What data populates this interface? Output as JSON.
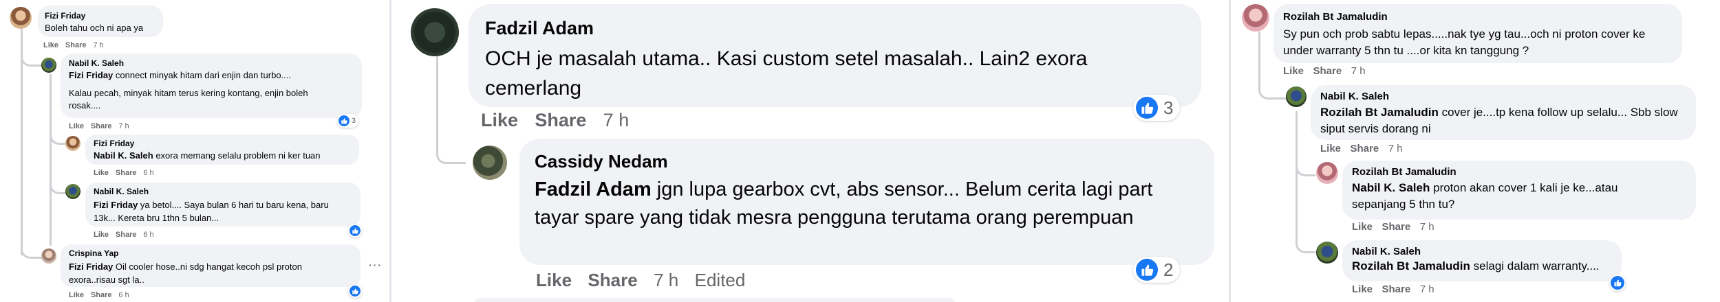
{
  "reaction_color": "#1877f2",
  "left": {
    "comments": [
      {
        "name": "Fizi Friday",
        "body": "Boleh tahu och ni apa ya",
        "like": "Like",
        "share": "Share",
        "time": "7 h"
      },
      {
        "name": "Nabil K. Saleh",
        "mention": "Fizi Friday",
        "body": "connect minyak hitam dari enjin dan turbo....",
        "body2": "Kalau pecah, minyak hitam terus kering kontang, enjin boleh rosak....",
        "reactions": "3",
        "like": "Like",
        "share": "Share",
        "time": "7 h"
      },
      {
        "name": "Fizi Friday",
        "mention": "Nabil K. Saleh",
        "body": "exora memang selalu problem ni ker tuan",
        "like": "Like",
        "share": "Share",
        "time": "6 h"
      },
      {
        "name": "Nabil K. Saleh",
        "mention": "Fizi Friday",
        "body": "ya betol.... Saya bulan 6 hari tu baru kena, baru 13k... Kereta bru 1thn 5 bulan...",
        "like": "Like",
        "share": "Share",
        "time": "6 h"
      },
      {
        "name": "Crispina Yap",
        "mention": "Fizi Friday",
        "body": "Oil cooler hose..ni sdg hangat kecoh psl proton exora..risau sgt la..",
        "more": "···",
        "like": "Like",
        "share": "Share",
        "time": "6 h"
      }
    ]
  },
  "middle": {
    "comments": [
      {
        "name": "Fadzil Adam",
        "body": "OCH je masalah utama.. Kasi custom setel masalah.. Lain2 exora cemerlang",
        "reactions": "3",
        "like": "Like",
        "share": "Share",
        "time": "7 h"
      },
      {
        "name": "Cassidy Nedam",
        "mention": "Fadzil Adam",
        "body": "jgn lupa gearbox cvt, abs sensor... Belum cerita lagi part tayar spare yang tidak mesra pengguna terutama orang perempuan",
        "reactions": "2",
        "like": "Like",
        "share": "Share",
        "time": "7 h",
        "edited": "Edited"
      }
    ]
  },
  "right": {
    "comments": [
      {
        "name": "Rozilah Bt Jamaludin",
        "body": "Sy pun och prob sabtu lepas.....nak tye yg tau...och ni proton cover ke under warranty 5 thn tu ....or kita kn tanggung ?",
        "like": "Like",
        "share": "Share",
        "time": "7 h"
      },
      {
        "name": "Nabil K. Saleh",
        "mention": "Rozilah Bt Jamaludin",
        "body": "cover je....tp kena follow up selalu... Sbb slow siput servis dorang ni",
        "like": "Like",
        "share": "Share",
        "time": "7 h"
      },
      {
        "name": "Rozilah Bt Jamaludin",
        "mention": "Nabil K. Saleh",
        "body": "proton akan cover 1 kali je ke...atau sepanjang 5 thn tu?",
        "like": "Like",
        "share": "Share",
        "time": "7 h"
      },
      {
        "name": "Nabil K. Saleh",
        "mention": "Rozilah Bt Jamaludin",
        "body": "selagi dalam warranty....",
        "like": "Like",
        "share": "Share",
        "time": "7 h"
      }
    ]
  }
}
